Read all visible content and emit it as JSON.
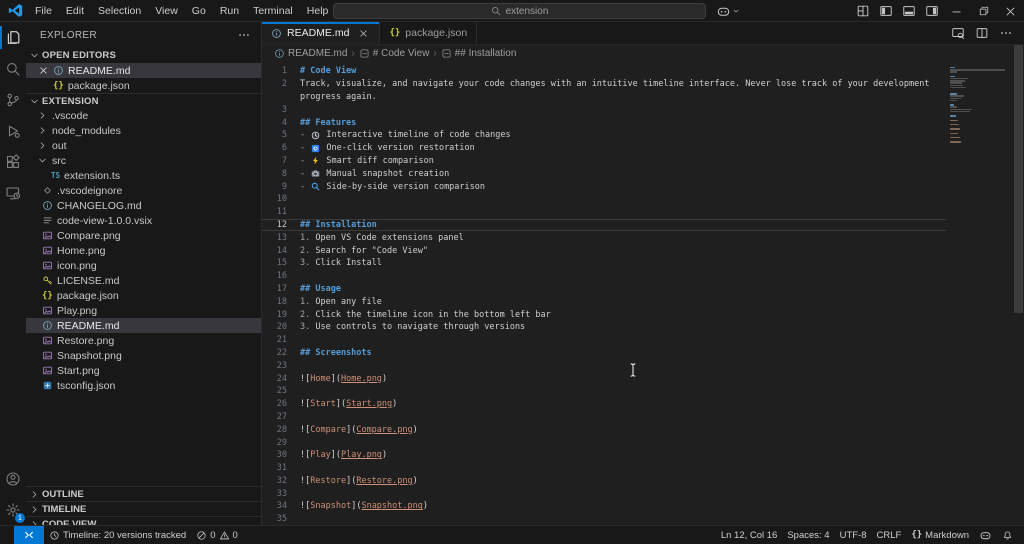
{
  "title_bar": {
    "menus": [
      "File",
      "Edit",
      "Selection",
      "View",
      "Go",
      "Run",
      "Terminal",
      "Help"
    ],
    "command_center_text": "extension",
    "right_icons": [
      "customize-layout",
      "panel-left",
      "panel-bottom",
      "panel-right",
      "minimize",
      "maximize",
      "close"
    ]
  },
  "activity_bar": {
    "top": [
      {
        "name": "explorer",
        "active": true
      },
      {
        "name": "search"
      },
      {
        "name": "source-control"
      },
      {
        "name": "run-debug"
      },
      {
        "name": "extensions"
      },
      {
        "name": "code-view"
      }
    ],
    "bottom": [
      {
        "name": "account"
      },
      {
        "name": "settings",
        "badge": "1"
      }
    ]
  },
  "sidebar": {
    "title": "EXPLORER",
    "open_editors_label": "OPEN EDITORS",
    "open_editors": [
      {
        "label": "README.md",
        "icon": "info",
        "active": true,
        "closable": true
      },
      {
        "label": "package.json",
        "icon": "json"
      }
    ],
    "section_label": "EXTENSION",
    "tree": [
      {
        "label": ".vscode",
        "kind": "folder"
      },
      {
        "label": "node_modules",
        "kind": "folder"
      },
      {
        "label": "out",
        "kind": "folder"
      },
      {
        "label": "src",
        "kind": "folder",
        "expanded": true
      },
      {
        "label": "extension.ts",
        "icon": "ts",
        "child": true
      },
      {
        "label": ".vscodeignore",
        "icon": "ignore"
      },
      {
        "label": "CHANGELOG.md",
        "icon": "info"
      },
      {
        "label": "code-view-1.0.0.vsix",
        "icon": "vsix"
      },
      {
        "label": "Compare.png",
        "icon": "image"
      },
      {
        "label": "Home.png",
        "icon": "image"
      },
      {
        "label": "icon.png",
        "icon": "image"
      },
      {
        "label": "LICENSE.md",
        "icon": "license"
      },
      {
        "label": "package.json",
        "icon": "json"
      },
      {
        "label": "Play.png",
        "icon": "image"
      },
      {
        "label": "README.md",
        "icon": "info",
        "selected": true
      },
      {
        "label": "Restore.png",
        "icon": "image"
      },
      {
        "label": "Snapshot.png",
        "icon": "image"
      },
      {
        "label": "Start.png",
        "icon": "image"
      },
      {
        "label": "tsconfig.json",
        "icon": "tsconfig"
      }
    ],
    "bottom_sections": [
      "OUTLINE",
      "TIMELINE",
      "CODE VIEW"
    ]
  },
  "tabs": [
    {
      "label": "README.md",
      "icon": "info",
      "active": true
    },
    {
      "label": "package.json",
      "icon": "json"
    }
  ],
  "breadcrumb": [
    {
      "label": "README.md",
      "icon": "info"
    },
    {
      "label": "# Code View",
      "icon": "symbol"
    },
    {
      "label": "## Installation",
      "icon": "symbol"
    }
  ],
  "editor": {
    "lines": [
      {
        "n": "1",
        "seg": [
          {
            "c": "h",
            "t": "# Code View"
          }
        ]
      },
      {
        "n": "2",
        "seg": [
          {
            "c": "t",
            "t": "Track, visualize, and navigate your code changes with an intuitive timeline interface. Never lose track of your development"
          }
        ]
      },
      {
        "n": "",
        "seg": [
          {
            "c": "t",
            "t": "progress again."
          }
        ]
      },
      {
        "n": "3",
        "seg": []
      },
      {
        "n": "4",
        "seg": [
          {
            "c": "h",
            "t": "## Features"
          }
        ]
      },
      {
        "n": "5",
        "seg": [
          {
            "c": "m",
            "t": "- "
          },
          {
            "icon": "clock-emoji"
          },
          {
            "c": "t",
            "t": " Interactive timeline of code changes"
          }
        ]
      },
      {
        "n": "6",
        "seg": [
          {
            "c": "m",
            "t": "- "
          },
          {
            "icon": "restore-emoji"
          },
          {
            "c": "t",
            "t": " One-click version restoration"
          }
        ]
      },
      {
        "n": "7",
        "seg": [
          {
            "c": "m",
            "t": "- "
          },
          {
            "icon": "bolt-emoji"
          },
          {
            "c": "t",
            "t": " Smart diff comparison"
          }
        ]
      },
      {
        "n": "8",
        "seg": [
          {
            "c": "m",
            "t": "- "
          },
          {
            "icon": "camera-emoji"
          },
          {
            "c": "t",
            "t": " Manual snapshot creation"
          }
        ]
      },
      {
        "n": "9",
        "seg": [
          {
            "c": "m",
            "t": "- "
          },
          {
            "icon": "magnifier-emoji"
          },
          {
            "c": "t",
            "t": " Side-by-side version comparison"
          }
        ]
      },
      {
        "n": "10",
        "seg": []
      },
      {
        "n": "11",
        "seg": []
      },
      {
        "n": "12",
        "current": true,
        "seg": [
          {
            "c": "h",
            "t": "## Installation"
          }
        ]
      },
      {
        "n": "13",
        "seg": [
          {
            "c": "m",
            "t": "1. "
          },
          {
            "c": "t",
            "t": "Open VS Code extensions panel"
          }
        ]
      },
      {
        "n": "14",
        "seg": [
          {
            "c": "m",
            "t": "2. "
          },
          {
            "c": "t",
            "t": "Search for \"Code View\""
          }
        ]
      },
      {
        "n": "15",
        "seg": [
          {
            "c": "m",
            "t": "3. "
          },
          {
            "c": "t",
            "t": "Click Install"
          }
        ]
      },
      {
        "n": "16",
        "seg": []
      },
      {
        "n": "17",
        "seg": [
          {
            "c": "h",
            "t": "## Usage"
          }
        ]
      },
      {
        "n": "18",
        "seg": [
          {
            "c": "m",
            "t": "1. "
          },
          {
            "c": "t",
            "t": "Open any file"
          }
        ]
      },
      {
        "n": "19",
        "seg": [
          {
            "c": "m",
            "t": "2. "
          },
          {
            "c": "t",
            "t": "Click the timeline icon in the bottom left bar"
          }
        ]
      },
      {
        "n": "20",
        "seg": [
          {
            "c": "m",
            "t": "3. "
          },
          {
            "c": "t",
            "t": "Use controls to navigate through versions"
          }
        ]
      },
      {
        "n": "21",
        "seg": []
      },
      {
        "n": "22",
        "seg": [
          {
            "c": "h",
            "t": "## Screenshots"
          }
        ]
      },
      {
        "n": "23",
        "seg": []
      },
      {
        "n": "24",
        "seg": [
          {
            "c": "p",
            "t": "!["
          },
          {
            "c": "lk",
            "t": "Home"
          },
          {
            "c": "p",
            "t": "]("
          },
          {
            "c": "lu",
            "t": "Home.png"
          },
          {
            "c": "p",
            "t": ")"
          }
        ]
      },
      {
        "n": "25",
        "seg": []
      },
      {
        "n": "26",
        "seg": [
          {
            "c": "p",
            "t": "!["
          },
          {
            "c": "lk",
            "t": "Start"
          },
          {
            "c": "p",
            "t": "]("
          },
          {
            "c": "lu",
            "t": "Start.png"
          },
          {
            "c": "p",
            "t": ")"
          }
        ]
      },
      {
        "n": "27",
        "seg": []
      },
      {
        "n": "28",
        "seg": [
          {
            "c": "p",
            "t": "!["
          },
          {
            "c": "lk",
            "t": "Compare"
          },
          {
            "c": "p",
            "t": "]("
          },
          {
            "c": "lu",
            "t": "Compare.png"
          },
          {
            "c": "p",
            "t": ")"
          }
        ]
      },
      {
        "n": "29",
        "seg": []
      },
      {
        "n": "30",
        "seg": [
          {
            "c": "p",
            "t": "!["
          },
          {
            "c": "lk",
            "t": "Play"
          },
          {
            "c": "p",
            "t": "]("
          },
          {
            "c": "lu",
            "t": "Play.png"
          },
          {
            "c": "p",
            "t": ")"
          }
        ]
      },
      {
        "n": "31",
        "seg": []
      },
      {
        "n": "32",
        "seg": [
          {
            "c": "p",
            "t": "!["
          },
          {
            "c": "lk",
            "t": "Restore"
          },
          {
            "c": "p",
            "t": "]("
          },
          {
            "c": "lu",
            "t": "Restore.png"
          },
          {
            "c": "p",
            "t": ")"
          }
        ]
      },
      {
        "n": "33",
        "seg": []
      },
      {
        "n": "34",
        "seg": [
          {
            "c": "p",
            "t": "!["
          },
          {
            "c": "lk",
            "t": "Snapshot"
          },
          {
            "c": "p",
            "t": "]("
          },
          {
            "c": "lu",
            "t": "Snapshot.png"
          },
          {
            "c": "p",
            "t": ")"
          }
        ]
      },
      {
        "n": "35",
        "seg": []
      }
    ]
  },
  "status_bar": {
    "timeline": "Timeline: 20 versions tracked",
    "errors": "0",
    "warnings": "0",
    "line_col": "Ln 12, Col 16",
    "spaces": "Spaces: 4",
    "encoding": "UTF-8",
    "eol": "CRLF",
    "language": "Markdown",
    "language_braces": "{}"
  },
  "colors": {
    "accent": "#0078d4",
    "chrome_bg": "#181818",
    "editor_bg": "#1f1f1f",
    "heading": "#569cd6",
    "link": "#ce9178",
    "selection_bg": "#37373d"
  }
}
